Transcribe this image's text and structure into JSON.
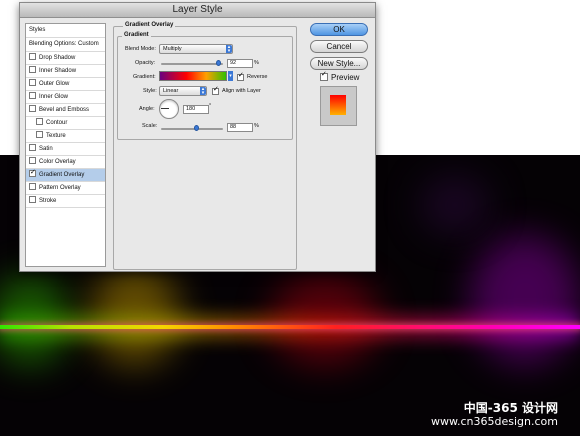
{
  "dialog": {
    "title": "Layer Style",
    "sidebar": [
      {
        "label": "Styles",
        "checkbox": false,
        "header": true
      },
      {
        "label": "Blending Options: Custom",
        "checkbox": false,
        "header": true
      },
      {
        "label": "Drop Shadow",
        "checkbox": true,
        "checked": false
      },
      {
        "label": "Inner Shadow",
        "checkbox": true,
        "checked": false
      },
      {
        "label": "Outer Glow",
        "checkbox": true,
        "checked": false
      },
      {
        "label": "Inner Glow",
        "checkbox": true,
        "checked": false
      },
      {
        "label": "Bevel and Emboss",
        "checkbox": true,
        "checked": false
      },
      {
        "label": "Contour",
        "checkbox": true,
        "checked": false,
        "indent": true
      },
      {
        "label": "Texture",
        "checkbox": true,
        "checked": false,
        "indent": true
      },
      {
        "label": "Satin",
        "checkbox": true,
        "checked": false
      },
      {
        "label": "Color Overlay",
        "checkbox": true,
        "checked": false
      },
      {
        "label": "Gradient Overlay",
        "checkbox": true,
        "checked": true,
        "active": true
      },
      {
        "label": "Pattern Overlay",
        "checkbox": true,
        "checked": false
      },
      {
        "label": "Stroke",
        "checkbox": true,
        "checked": false
      }
    ],
    "panel": {
      "outer_title": "Gradient Overlay",
      "inner_title": "Gradient",
      "blend_mode_label": "Blend Mode:",
      "blend_mode_value": "Multiply",
      "opacity_label": "Opacity:",
      "opacity_value": "92",
      "opacity_fraction": 0.92,
      "percent_sign": "%",
      "gradient_label": "Gradient:",
      "reverse_label": "Reverse",
      "reverse_checked": true,
      "style_label": "Style:",
      "style_value": "Linear",
      "align_label": "Align with Layer",
      "align_checked": true,
      "angle_label": "Angle:",
      "angle_value": "180",
      "degree_sign": "°",
      "scale_label": "Scale:",
      "scale_value": "88",
      "scale_fraction": 0.58
    },
    "buttons": {
      "ok": "OK",
      "cancel": "Cancel",
      "new_style": "New Style..."
    },
    "preview_label": "Preview",
    "preview_checked": true
  },
  "watermark": {
    "line1": "中国-365 设计网",
    "line2": "www.cn365design.com"
  },
  "colors": {
    "accent": "#3b78d6",
    "selection": "#b4cdea",
    "background": "#050205"
  }
}
